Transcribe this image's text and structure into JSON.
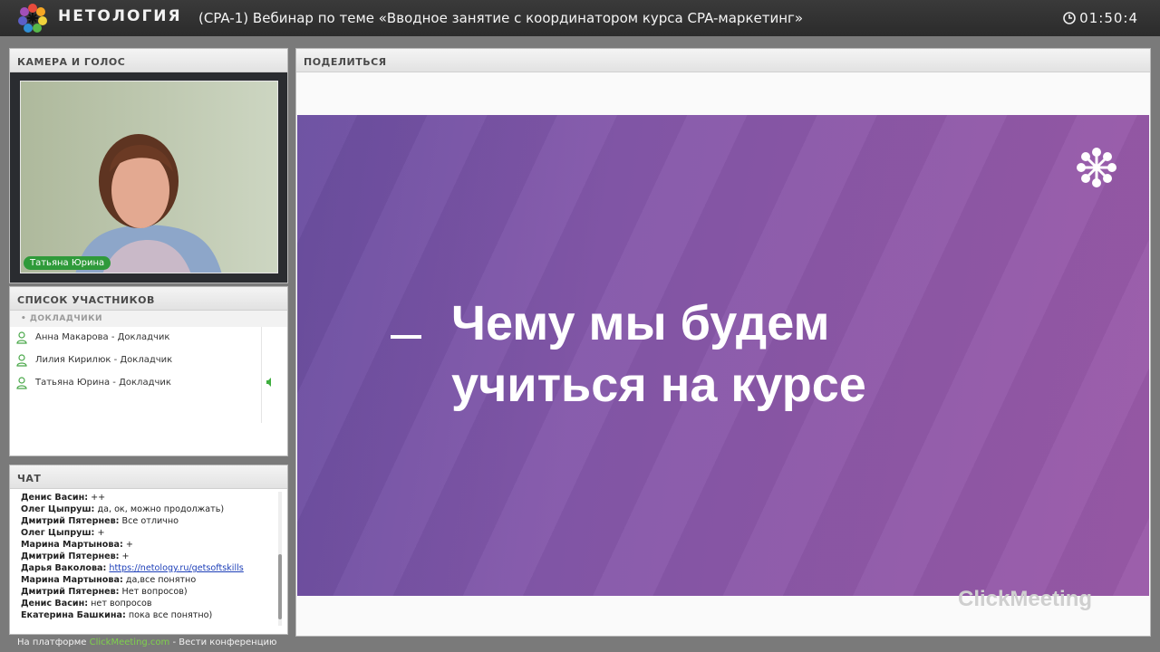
{
  "header": {
    "brand": "НЕТОЛОГИЯ",
    "title": "(CPA-1) Вебинар по теме «Вводное занятие с координатором курса CPA-маркетинг»",
    "timer": "01:50:4"
  },
  "camera": {
    "heading": "КАМЕРА И ГОЛОС",
    "presenter_name": "Татьяна Юрина"
  },
  "participants": {
    "heading": "СПИСОК УЧАСТНИКОВ",
    "group_label": "ДОКЛАДЧИКИ",
    "items": [
      {
        "name": "Анна Макарова  - Докладчик",
        "speaking": false
      },
      {
        "name": "Лилия Кирилюк  - Докладчик",
        "speaking": false
      },
      {
        "name": "Татьяна Юрина - Докладчик",
        "speaking": true
      }
    ]
  },
  "chat": {
    "heading": "ЧАТ",
    "messages": [
      {
        "author": "Денис Васин:",
        "text": " ++"
      },
      {
        "author": "Олег Цыпруш:",
        "text": " да, ок, можно продолжать)"
      },
      {
        "author": "Дмитрий Пятернев:",
        "text": " Все отлично"
      },
      {
        "author": "Олег Цыпруш:",
        "text": " +"
      },
      {
        "author": "Марина Мартынова:",
        "text": " +"
      },
      {
        "author": "Дмитрий Пятернев:",
        "text": " +"
      },
      {
        "author": "Дарья Ваколова:",
        "text": "",
        "link": "https://netology.ru/getsoftskills"
      },
      {
        "author": "Марина Мартынова:",
        "text": " да,все понятно"
      },
      {
        "author": "Дмитрий Пятернев:",
        "text": " Нет вопросов)"
      },
      {
        "author": "Денис Васин:",
        "text": " нет вопросов"
      },
      {
        "author": "Екатерина Башкина:",
        "text": " пока все понятно)"
      }
    ]
  },
  "footer": {
    "prefix": "На платформе ",
    "platform": "ClickMeeting.com",
    "suffix": " - Вести конференцию"
  },
  "share": {
    "heading": "ПОДЕЛИТЬСЯ",
    "slide_line1": "Чему мы будем",
    "slide_line2": "учиться на курсе",
    "watermark": "ClickMeeting"
  },
  "colors": {
    "accent_green": "#2f9a3a",
    "slide_purple": "#8458aa",
    "link_green": "#7fd14d"
  }
}
